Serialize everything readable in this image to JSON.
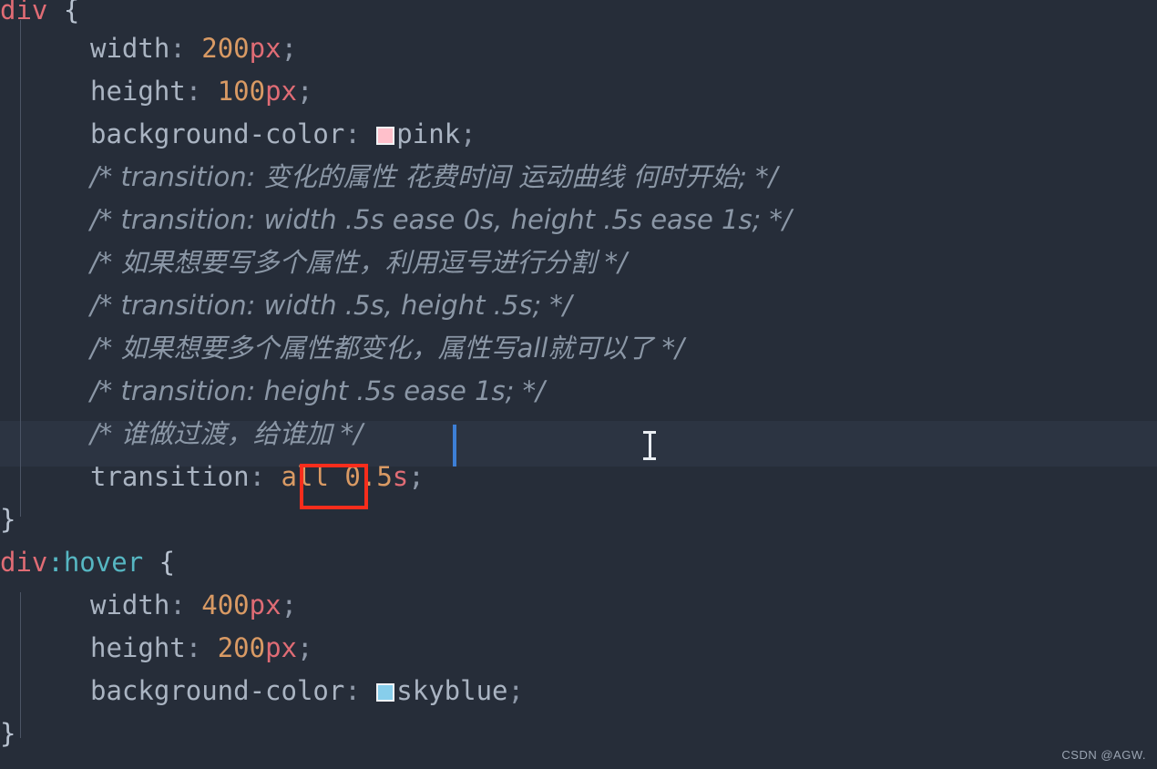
{
  "editor": {
    "theme_name": "dark-one-like",
    "background_color": "#262d39",
    "current_line_color": "#2c3442",
    "annotation_color": "#f92d1c",
    "caret_color": "#3d7fd6",
    "lines": [
      {
        "id": "l1",
        "indent": 0,
        "tokens": [
          {
            "kind": "selector",
            "text": "div"
          },
          {
            "kind": "space",
            "text": " "
          },
          {
            "kind": "brace",
            "text": "{"
          }
        ]
      },
      {
        "id": "l2",
        "indent": 1,
        "tokens": [
          {
            "kind": "property",
            "text": "width"
          },
          {
            "kind": "punctuation",
            "text": ":"
          },
          {
            "kind": "space",
            "text": " "
          },
          {
            "kind": "number",
            "text": "200"
          },
          {
            "kind": "unit",
            "text": "px"
          },
          {
            "kind": "punctuation",
            "text": ";"
          }
        ]
      },
      {
        "id": "l3",
        "indent": 1,
        "tokens": [
          {
            "kind": "property",
            "text": "height"
          },
          {
            "kind": "punctuation",
            "text": ":"
          },
          {
            "kind": "space",
            "text": " "
          },
          {
            "kind": "number",
            "text": "100"
          },
          {
            "kind": "unit",
            "text": "px"
          },
          {
            "kind": "punctuation",
            "text": ";"
          }
        ]
      },
      {
        "id": "l4",
        "indent": 1,
        "tokens": [
          {
            "kind": "property",
            "text": "background-color"
          },
          {
            "kind": "punctuation",
            "text": ":"
          },
          {
            "kind": "space",
            "text": " "
          },
          {
            "kind": "swatch",
            "text": "pink",
            "color": "#ffc0cb"
          },
          {
            "kind": "value",
            "text": "pink"
          },
          {
            "kind": "punctuation",
            "text": ";"
          }
        ]
      },
      {
        "id": "l5",
        "indent": 1,
        "comment": "/* transition: 变化的属性 花费时间 运动曲线 何时开始; */"
      },
      {
        "id": "l6",
        "indent": 1,
        "comment": "/* transition: width .5s ease 0s, height .5s ease 1s; */"
      },
      {
        "id": "l7",
        "indent": 1,
        "comment": "/* 如果想要写多个属性，利用逗号进行分割 */"
      },
      {
        "id": "l8",
        "indent": 1,
        "comment": "/* transition: width .5s, height .5s; */"
      },
      {
        "id": "l9",
        "indent": 1,
        "comment": "/* 如果想要多个属性都变化，属性写all就可以了 */"
      },
      {
        "id": "l10",
        "indent": 1,
        "comment": "/* transition: height .5s ease 1s; */"
      },
      {
        "id": "l11",
        "indent": 1,
        "comment": "/* 谁做过渡，给谁加 */",
        "current": true
      },
      {
        "id": "l12",
        "indent": 1,
        "tokens": [
          {
            "kind": "property",
            "text": "transition"
          },
          {
            "kind": "punctuation",
            "text": ":"
          },
          {
            "kind": "space",
            "text": " "
          },
          {
            "kind": "number",
            "text": "all"
          },
          {
            "kind": "space",
            "text": " "
          },
          {
            "kind": "number",
            "text": "0.5"
          },
          {
            "kind": "unit",
            "text": "s"
          },
          {
            "kind": "punctuation",
            "text": ";"
          }
        ]
      },
      {
        "id": "l13",
        "indent": 0,
        "tokens": [
          {
            "kind": "brace",
            "text": "}"
          }
        ]
      },
      {
        "id": "l14",
        "indent": 0,
        "tokens": [
          {
            "kind": "selector",
            "text": "div"
          },
          {
            "kind": "pseudo",
            "text": ":hover"
          },
          {
            "kind": "space",
            "text": " "
          },
          {
            "kind": "brace",
            "text": "{"
          }
        ]
      },
      {
        "id": "l15",
        "indent": 1,
        "tokens": [
          {
            "kind": "property",
            "text": "width"
          },
          {
            "kind": "punctuation",
            "text": ":"
          },
          {
            "kind": "space",
            "text": " "
          },
          {
            "kind": "number",
            "text": "400"
          },
          {
            "kind": "unit",
            "text": "px"
          },
          {
            "kind": "punctuation",
            "text": ";"
          }
        ]
      },
      {
        "id": "l16",
        "indent": 1,
        "tokens": [
          {
            "kind": "property",
            "text": "height"
          },
          {
            "kind": "punctuation",
            "text": ":"
          },
          {
            "kind": "space",
            "text": " "
          },
          {
            "kind": "number",
            "text": "200"
          },
          {
            "kind": "unit",
            "text": "px"
          },
          {
            "kind": "punctuation",
            "text": ";"
          }
        ]
      },
      {
        "id": "l17",
        "indent": 1,
        "tokens": [
          {
            "kind": "property",
            "text": "background-color"
          },
          {
            "kind": "punctuation",
            "text": ":"
          },
          {
            "kind": "space",
            "text": " "
          },
          {
            "kind": "swatch",
            "text": "skyblue",
            "color": "#87ceeb"
          },
          {
            "kind": "value",
            "text": "skyblue"
          },
          {
            "kind": "punctuation",
            "text": ";"
          }
        ]
      },
      {
        "id": "l18",
        "indent": 0,
        "tokens": [
          {
            "kind": "brace",
            "text": "}"
          }
        ]
      }
    ]
  },
  "code": {
    "line1": "div {",
    "l2_prop": "width",
    "l2_colon": ":",
    "l2_num": "200",
    "l2_unit": "px",
    "l2_semi": ";",
    "l3_prop": "height",
    "l3_colon": ":",
    "l3_num": "100",
    "l3_unit": "px",
    "l3_semi": ";",
    "l4_prop": "background-color",
    "l4_colon": ":",
    "l4_val": "pink",
    "l4_semi": ";",
    "l5_comment": "/* transition: 变化的属性 花费时间 运动曲线 何时开始; */",
    "l6_comment": "/* transition: width .5s ease 0s, height .5s ease 1s; */",
    "l7_comment": "/* 如果想要写多个属性，利用逗号进行分割 */",
    "l8_comment": "/* transition: width .5s, height .5s; */",
    "l9_comment": "/* 如果想要多个属性都变化，属性写all就可以了 */",
    "l10_comment": "/* transition: height .5s ease 1s; */",
    "l11_comment": "/* 谁做过渡，给谁加 */",
    "l12_prop": "transition",
    "l12_colon": ":",
    "l12_all": "all",
    "l12_num": "0.5",
    "l12_unit": "s",
    "l12_semi": ";",
    "l13_brace": "}",
    "l14_sel": "div",
    "l14_pseudo": ":hover",
    "l14_brace": "{",
    "l15_prop": "width",
    "l15_colon": ":",
    "l15_num": "400",
    "l15_unit": "px",
    "l15_semi": ";",
    "l16_prop": "height",
    "l16_colon": ":",
    "l16_num": "200",
    "l16_unit": "px",
    "l16_semi": ";",
    "l17_prop": "background-color",
    "l17_colon": ":",
    "l17_val": "skyblue",
    "l17_semi": ";",
    "l18_brace": "}",
    "l1_sel": "div",
    "l1_brace": "{"
  },
  "swatches": {
    "pink": "#ffc0cb",
    "skyblue": "#87ceeb"
  },
  "annotation": {
    "highlighted_token": "all",
    "box_color": "#f92d1c"
  },
  "watermark": {
    "text": "CSDN @AGW."
  }
}
